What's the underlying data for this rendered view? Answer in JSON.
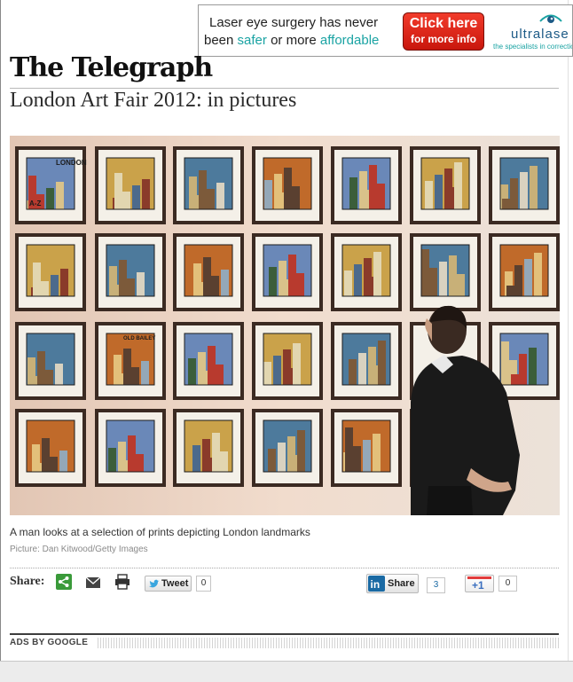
{
  "ad": {
    "line1": "Laser eye surgery has never",
    "line2_a": "been ",
    "line2_safer": "safer",
    "line2_b": " or more ",
    "line2_affordable": "affordable",
    "cta_line1": "Click here",
    "cta_line2": "for more info",
    "logo_word": "ultralase",
    "logo_tagline": "the specialists in correction",
    "colors": {
      "cta": "#e3231a",
      "teal": "#1aa3a3",
      "logo": "#1c5a86"
    }
  },
  "masthead": "The Telegraph",
  "article": {
    "title": "London Art Fair 2012: in pictures",
    "caption": "A man looks at a selection of prints depicting London landmarks",
    "credit": "Picture: Dan Kitwood/Getty Images"
  },
  "artwork": {
    "framed_labels": [
      "LONDON",
      "A-Z",
      "OLD BAILEY"
    ]
  },
  "share": {
    "label": "Share:",
    "icons": [
      "share-icon",
      "email-icon",
      "print-icon"
    ],
    "tweet_label": "Tweet",
    "tweet_count": "0",
    "linkedin_label": "Share",
    "linkedin_count": "3",
    "gplus_label": "+1",
    "gplus_count": "0"
  },
  "ads_footer": {
    "label": "ADS BY GOOGLE"
  }
}
